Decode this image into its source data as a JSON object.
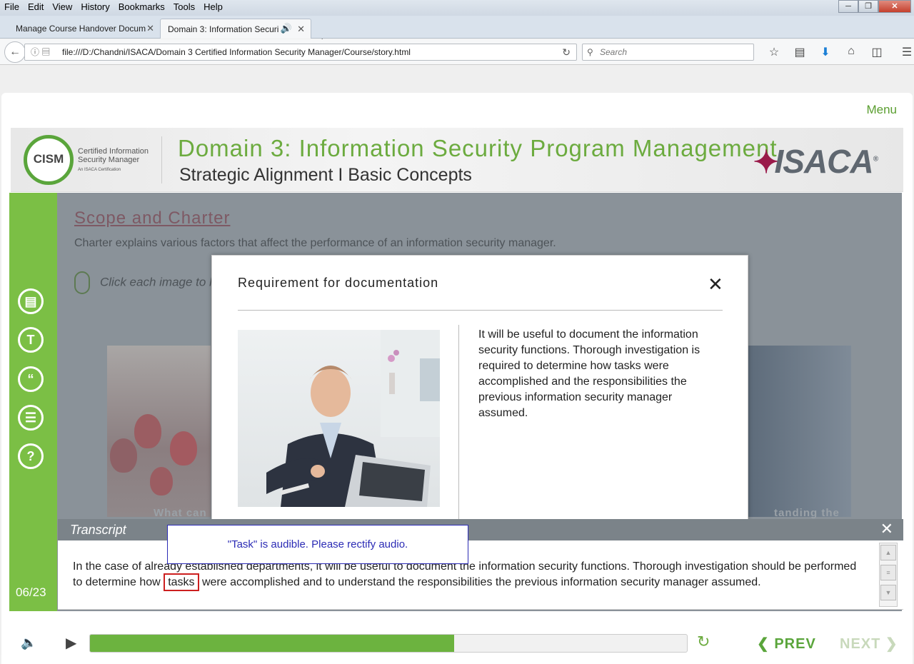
{
  "browser": {
    "menus": [
      "File",
      "Edit",
      "View",
      "History",
      "Bookmarks",
      "Tools",
      "Help"
    ],
    "tabs": [
      {
        "title": "Manage Course Handover Docum"
      },
      {
        "title": "Domain 3: Information Securi"
      }
    ],
    "url": "file:///D:/Chandni/ISACA/Domain 3 Certified Information Security Manager/Course/story.html",
    "search_placeholder": "Search"
  },
  "course": {
    "menu_label": "Menu",
    "banner": {
      "logo_text": "CISM",
      "logo_caption": "Certified Information Security Manager",
      "logo_small": "An ISACA Certification",
      "title": "Domain 3: Information Security Program Management",
      "subtitle": "Strategic Alignment I Basic Concepts",
      "brand": "ISACA"
    },
    "slide": {
      "heading": "Scope and Charter",
      "description": "Charter explains various factors that affect the performance of an information security manager.",
      "hint": "Click each image to l",
      "caption_left": "What can",
      "caption_right": "tanding the"
    },
    "slide_counter": "06/23"
  },
  "modal": {
    "title": "Requirement for documentation",
    "body": "It will be useful to document the information security functions. Thorough investigation is required to determine how tasks were accomplished and the responsibilities the previous information security manager assumed."
  },
  "transcript": {
    "title": "Transcript",
    "text_before": "In the case of already established departments, it will be useful to document the information security functions. Thorough investigation should be performed to determine how ",
    "highlight": "tasks",
    "text_after": " were accomplished and to understand the responsibilities the previous information security manager assumed.",
    "review_note": "\"Task\" is audible. Please rectify audio."
  },
  "player": {
    "progress_fraction": 0.61,
    "prev_label": "PREV",
    "next_label": "NEXT"
  },
  "colors": {
    "brand_green": "#6cab3f",
    "highlight_red": "#cc1f1f",
    "note_blue": "#2b2bb5"
  }
}
